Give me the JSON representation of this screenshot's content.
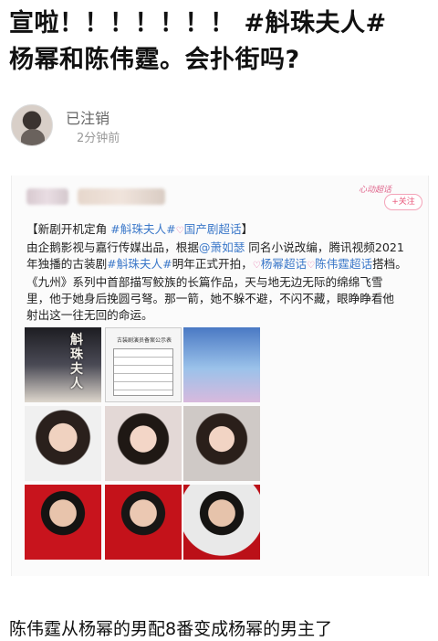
{
  "headline": {
    "line1": "宣啦！！！！！！！ #斛珠夫人#",
    "line2": "杨幂和陈伟霆。会扑街吗?"
  },
  "author": {
    "name": "已注销",
    "time": "2分钟前"
  },
  "card": {
    "badge_text": "心动超话",
    "follow_label": "+关注",
    "line1": {
      "prefix": "【新剧开机定角 ",
      "tag1": "#斛珠夫人#",
      "tag2_icon": "♡",
      "tag2": "国产剧超话",
      "suffix": "】"
    },
    "line2": {
      "text_a": "由企鹅影视与嘉行传媒出品，根据",
      "mention": "@萧如瑟",
      "text_b": " 同名小说改编，腾讯视频2021"
    },
    "line3": {
      "text_a": "年独播的古装剧",
      "tag": "#斛珠夫人#",
      "text_b": "明年正式开拍，",
      "tag_icon": "♡",
      "tag_yang": "杨幂超话",
      "tag_chen": "陈伟霆超话",
      "text_c": "搭档。"
    },
    "line4": "《九州》系列中首部描写鲛族的长篇作品，天与地无边无际的绵绵飞雪",
    "line5": "里，他于她身后挽圆弓弩。那一箭，她不躲不避，不闪不藏，眼睁睁看他",
    "line6": "射出这一往无回的命运。",
    "poster_text": "斛珠夫人",
    "doc_title": "古装剧演员备案公示表"
  },
  "comment": "陈伟霆从杨幂的男配8番变成杨幂的男主了"
}
